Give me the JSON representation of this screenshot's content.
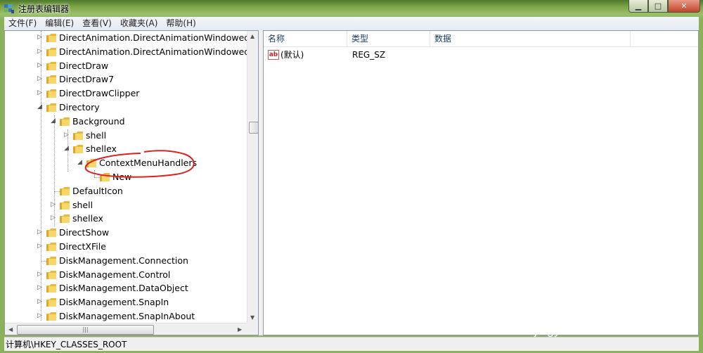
{
  "window": {
    "title": "注册表编辑器",
    "controls": {
      "minimize": "▁",
      "maximize": "□",
      "close": "✕"
    }
  },
  "menu": [
    {
      "label": "文件(F)"
    },
    {
      "label": "编辑(E)"
    },
    {
      "label": "查看(V)"
    },
    {
      "label": "收藏夹(A)"
    },
    {
      "label": "帮助(H)"
    }
  ],
  "tree": {
    "items": [
      {
        "label": "DirectAnimation.DirectAnimationWindowedInte",
        "expander": "collapsed"
      },
      {
        "label": "DirectAnimation.DirectAnimationWindowedInte",
        "expander": "collapsed"
      },
      {
        "label": "DirectDraw",
        "expander": "collapsed"
      },
      {
        "label": "DirectDraw7",
        "expander": "collapsed"
      },
      {
        "label": "DirectDrawClipper",
        "expander": "collapsed"
      },
      {
        "label": "Directory",
        "expander": "expanded"
      },
      {
        "label": "Background",
        "expander": "expanded"
      },
      {
        "label": "shell",
        "expander": "collapsed"
      },
      {
        "label": "shellex",
        "expander": "expanded"
      },
      {
        "label": "ContextMenuHandlers",
        "expander": "expanded"
      },
      {
        "label": "New",
        "expander": "none"
      },
      {
        "label": "DefaultIcon",
        "expander": "none"
      },
      {
        "label": "shell",
        "expander": "collapsed"
      },
      {
        "label": "shellex",
        "expander": "collapsed"
      },
      {
        "label": "DirectShow",
        "expander": "collapsed"
      },
      {
        "label": "DirectXFile",
        "expander": "collapsed"
      },
      {
        "label": "DiskManagement.Connection",
        "expander": "none"
      },
      {
        "label": "DiskManagement.Control",
        "expander": "collapsed"
      },
      {
        "label": "DiskManagement.DataObject",
        "expander": "collapsed"
      },
      {
        "label": "DiskManagement.SnapIn",
        "expander": "collapsed"
      },
      {
        "label": "DiskManagement.SnapInAbout",
        "expander": "collapsed"
      }
    ]
  },
  "list": {
    "columns": [
      "名称",
      "类型",
      "数据"
    ],
    "rows": [
      {
        "name": "(默认)",
        "type": "REG_SZ",
        "data": "",
        "icon": "string-value-icon"
      }
    ]
  },
  "statusbar": {
    "path": "计算机\\HKEY_CLASSES_ROOT"
  },
  "watermark": {
    "brand": "Bai du",
    "cn": "经验",
    "url": "jingyan.baidu.com"
  },
  "colors": {
    "accent": "#1e3c66",
    "annotation": "#e02020",
    "folder": "#f2c94c"
  }
}
